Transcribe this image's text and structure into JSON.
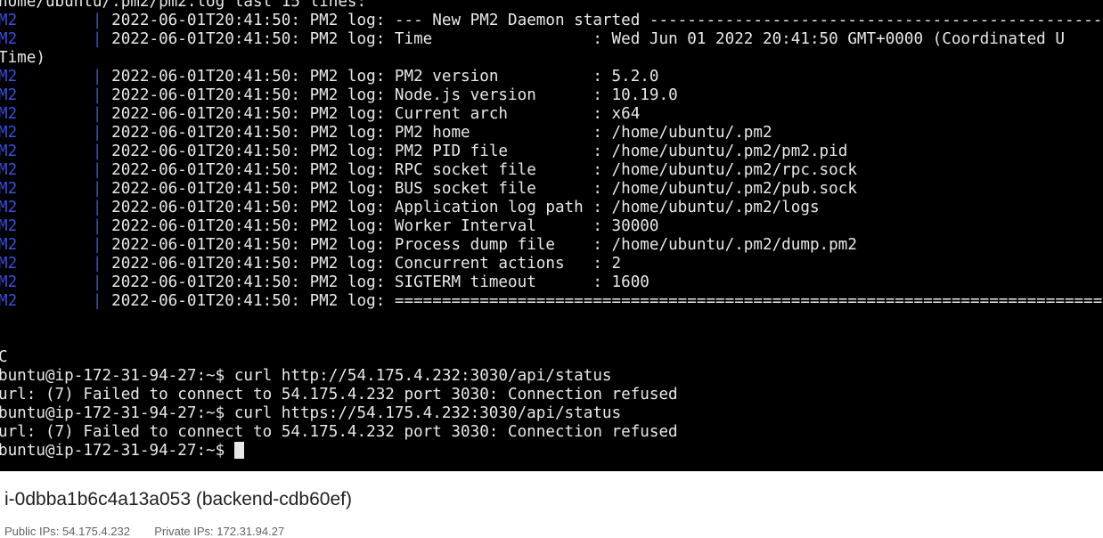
{
  "terminal": {
    "header_line": "home/ubuntu/.pm2/pm2.log last 15 lines:",
    "log_lines": [
      {
        "prefix": "M2",
        "text": "2022-06-01T20:41:50: PM2 log: --- New PM2 Daemon started ----------------------------------------------------------------"
      },
      {
        "prefix": "M2",
        "text": "2022-06-01T20:41:50: PM2 log: Time                 : Wed Jun 01 2022 20:41:50 GMT+0000 (Coordinated U"
      },
      {
        "prefix": "",
        "text": "Time)",
        "continuation": true
      },
      {
        "prefix": "M2",
        "text": "2022-06-01T20:41:50: PM2 log: PM2 version          : 5.2.0"
      },
      {
        "prefix": "M2",
        "text": "2022-06-01T20:41:50: PM2 log: Node.js version      : 10.19.0"
      },
      {
        "prefix": "M2",
        "text": "2022-06-01T20:41:50: PM2 log: Current arch         : x64"
      },
      {
        "prefix": "M2",
        "text": "2022-06-01T20:41:50: PM2 log: PM2 home             : /home/ubuntu/.pm2"
      },
      {
        "prefix": "M2",
        "text": "2022-06-01T20:41:50: PM2 log: PM2 PID file         : /home/ubuntu/.pm2/pm2.pid"
      },
      {
        "prefix": "M2",
        "text": "2022-06-01T20:41:50: PM2 log: RPC socket file      : /home/ubuntu/.pm2/rpc.sock"
      },
      {
        "prefix": "M2",
        "text": "2022-06-01T20:41:50: PM2 log: BUS socket file      : /home/ubuntu/.pm2/pub.sock"
      },
      {
        "prefix": "M2",
        "text": "2022-06-01T20:41:50: PM2 log: Application log path : /home/ubuntu/.pm2/logs"
      },
      {
        "prefix": "M2",
        "text": "2022-06-01T20:41:50: PM2 log: Worker Interval      : 30000"
      },
      {
        "prefix": "M2",
        "text": "2022-06-01T20:41:50: PM2 log: Process dump file    : /home/ubuntu/.pm2/dump.pm2"
      },
      {
        "prefix": "M2",
        "text": "2022-06-01T20:41:50: PM2 log: Concurrent actions   : 2"
      },
      {
        "prefix": "M2",
        "text": "2022-06-01T20:41:50: PM2 log: SIGTERM timeout      : 1600"
      },
      {
        "prefix": "M2",
        "text": "2022-06-01T20:41:50: PM2 log: ==========================================================================="
      }
    ],
    "interrupt": "C",
    "commands": [
      {
        "prompt": "buntu@ip-172-31-94-27:~$ ",
        "command": "curl http://54.175.4.232:3030/api/status"
      },
      {
        "output": "url: (7) Failed to connect to 54.175.4.232 port 3030: Connection refused"
      },
      {
        "prompt": "buntu@ip-172-31-94-27:~$ ",
        "command": "curl https://54.175.4.232:3030/api/status"
      },
      {
        "output": "url: (7) Failed to connect to 54.175.4.232 port 3030: Connection refused"
      }
    ],
    "current_prompt": "buntu@ip-172-31-94-27:~$ ",
    "colors": {
      "background": "#000000",
      "text": "#e8e8e8",
      "pm2_prefix": "#3a4fd8"
    }
  },
  "instance": {
    "title": "i-0dbba1b6c4a13a053 (backend-cdb60ef)",
    "public_ips_label": "Public IPs:",
    "public_ips": "54.175.4.232",
    "private_ips_label": "Private IPs:",
    "private_ips": "172.31.94.27"
  }
}
